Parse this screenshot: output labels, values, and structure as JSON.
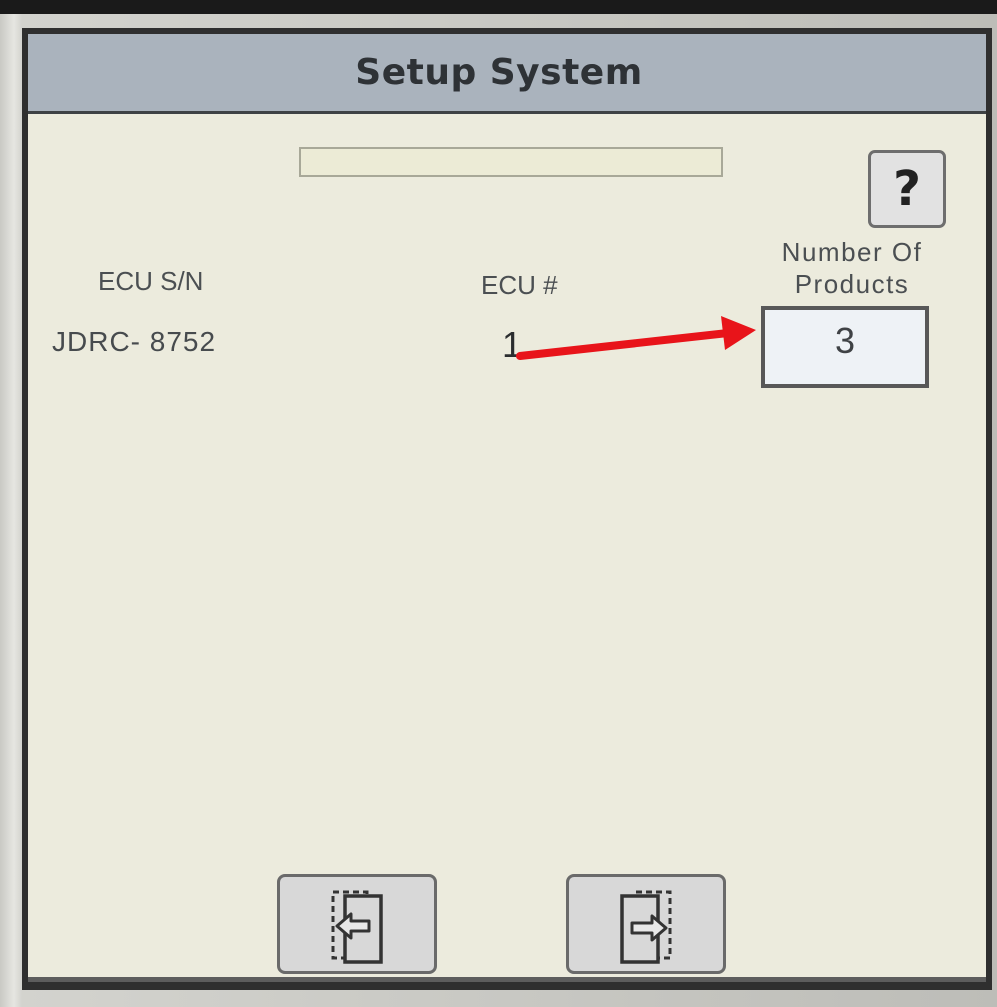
{
  "screen": {
    "title": "Setup System"
  },
  "help_button": {
    "label": "?"
  },
  "columns": {
    "ecu_sn_label": "ECU S/N",
    "ecu_num_label": "ECU #",
    "num_products_label_line1": "Number Of",
    "num_products_label_line2": "Products"
  },
  "row": {
    "ecu_sn": "JDRC- 8752",
    "ecu_num": "1",
    "num_products": "3"
  },
  "annotation": {
    "arrow_color": "#e8141a"
  },
  "nav": {
    "previous_icon": "page-back-icon",
    "next_icon": "page-forward-icon"
  },
  "colors": {
    "title_bar": "#aab3bd",
    "screen_background": "#ecebdd",
    "input_background": "#eef2f6"
  }
}
